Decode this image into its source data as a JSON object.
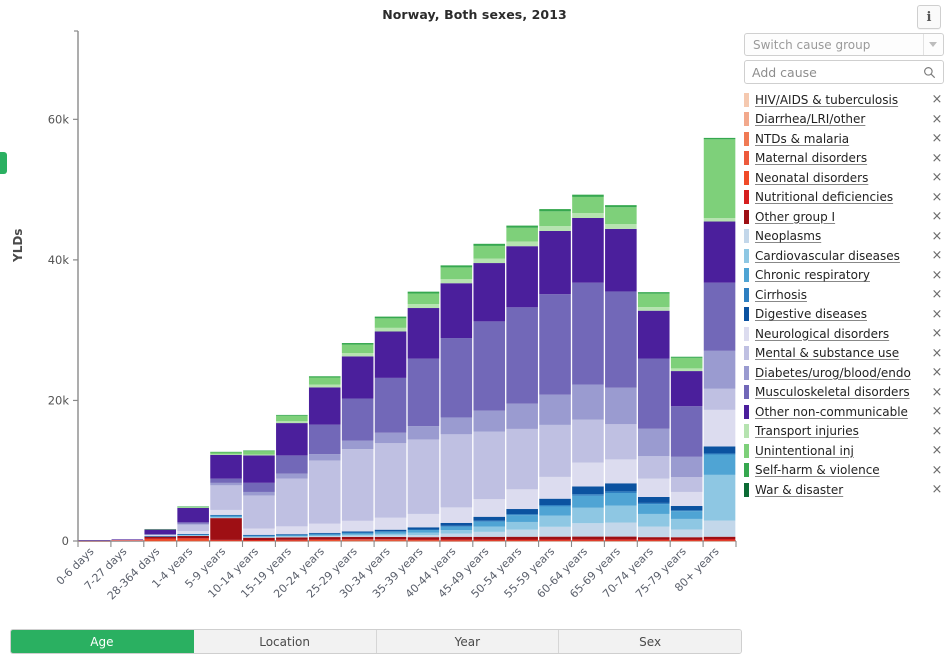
{
  "header": {
    "title": "Norway, Both sexes, 2013",
    "info_button": "i"
  },
  "controls": {
    "cause_group_placeholder": "Switch cause group",
    "add_cause_placeholder": "Add cause",
    "add_cause_value": "",
    "search_icon": "search-icon",
    "remove_icon": "×"
  },
  "legend": {
    "items": [
      {
        "label": "HIV/AIDS & tuberculosis",
        "color": "#f5c9b0"
      },
      {
        "label": "Diarrhea/LRI/other",
        "color": "#f2a98c"
      },
      {
        "label": "NTDs & malaria",
        "color": "#f07a54"
      },
      {
        "label": "Maternal disorders",
        "color": "#ed5a3c"
      },
      {
        "label": "Neonatal disorders",
        "color": "#f04a28"
      },
      {
        "label": "Nutritional deficiencies",
        "color": "#d61f1f"
      },
      {
        "label": "Other group I",
        "color": "#9e0f14"
      },
      {
        "label": "Neoplasms",
        "color": "#c3d7ea"
      },
      {
        "label": "Cardiovascular diseases",
        "color": "#8ec7e3"
      },
      {
        "label": "Chronic respiratory",
        "color": "#4fa4d4"
      },
      {
        "label": "Cirrhosis",
        "color": "#2e7fc1"
      },
      {
        "label": "Digestive diseases",
        "color": "#0b52a0"
      },
      {
        "label": "Neurological disorders",
        "color": "#dcdcef"
      },
      {
        "label": "Mental & substance use",
        "color": "#bfc0e2"
      },
      {
        "label": "Diabetes/urog/blood/endo",
        "color": "#9a9bd0"
      },
      {
        "label": "Musculoskeletal disorders",
        "color": "#7268b8"
      },
      {
        "label": "Other non-communicable",
        "color": "#4b1f9c"
      },
      {
        "label": "Transport injuries",
        "color": "#b6e3b0"
      },
      {
        "label": "Unintentional inj",
        "color": "#7ed07a"
      },
      {
        "label": "Self-harm & violence",
        "color": "#36a84f"
      },
      {
        "label": "War & disaster",
        "color": "#0c6b34"
      }
    ]
  },
  "tabs": {
    "items": [
      {
        "label": "Age",
        "active": true
      },
      {
        "label": "Location",
        "active": false
      },
      {
        "label": "Year",
        "active": false
      },
      {
        "label": "Sex",
        "active": false
      }
    ]
  },
  "chart_data": {
    "type": "bar",
    "stacked": true,
    "title": "Norway, Both sexes, 2013",
    "xlabel": "",
    "ylabel": "YLDs",
    "ylim": [
      0,
      72000
    ],
    "yticks": [
      0,
      20000,
      40000,
      60000
    ],
    "ytick_labels": [
      "0",
      "20k",
      "40k",
      "60k"
    ],
    "grid": false,
    "legend_position": "right",
    "categories": [
      "0-6 days",
      "7-27 days",
      "28-364 days",
      "1-4 years",
      "5-9 years",
      "10-14 years",
      "15-19 years",
      "20-24 years",
      "25-29 years",
      "30-34 years",
      "35-39 years",
      "40-44 years",
      "45-49 years",
      "50-54 years",
      "55-59 years",
      "60-64 years",
      "65-69 years",
      "70-74 years",
      "75-79 years",
      "80+ years"
    ],
    "series": [
      {
        "name": "HIV/AIDS & tuberculosis",
        "color": "#f5c9b0",
        "values": [
          0,
          0,
          0,
          0,
          0,
          0,
          0,
          0,
          0,
          0,
          0,
          0,
          0,
          0,
          0,
          0,
          0,
          0,
          0,
          0
        ]
      },
      {
        "name": "Diarrhea/LRI/other",
        "color": "#f2a98c",
        "values": [
          0,
          0,
          10,
          20,
          20,
          20,
          20,
          20,
          20,
          20,
          20,
          20,
          20,
          20,
          20,
          20,
          20,
          20,
          20,
          20
        ]
      },
      {
        "name": "NTDs & malaria",
        "color": "#f07a54",
        "values": [
          0,
          0,
          0,
          0,
          0,
          0,
          0,
          0,
          0,
          0,
          0,
          0,
          0,
          0,
          0,
          0,
          0,
          0,
          0,
          0
        ]
      },
      {
        "name": "Maternal disorders",
        "color": "#ed5a3c",
        "values": [
          0,
          0,
          0,
          0,
          0,
          0,
          20,
          70,
          90,
          80,
          40,
          10,
          0,
          0,
          0,
          0,
          0,
          0,
          0,
          0
        ]
      },
      {
        "name": "Neonatal disorders",
        "color": "#f04a28",
        "values": [
          60,
          120,
          330,
          330,
          80,
          60,
          60,
          60,
          60,
          60,
          60,
          60,
          60,
          60,
          60,
          60,
          60,
          60,
          60,
          60
        ]
      },
      {
        "name": "Nutritional deficiencies",
        "color": "#d61f1f",
        "values": [
          0,
          10,
          30,
          60,
          60,
          60,
          70,
          80,
          90,
          90,
          100,
          110,
          120,
          130,
          140,
          150,
          150,
          140,
          130,
          200
        ]
      },
      {
        "name": "Other group I",
        "color": "#9e0f14",
        "values": [
          10,
          30,
          300,
          330,
          3100,
          330,
          330,
          330,
          330,
          330,
          330,
          400,
          400,
          400,
          400,
          400,
          400,
          330,
          330,
          330
        ]
      },
      {
        "name": "Neoplasms",
        "color": "#c3d7ea",
        "values": [
          0,
          0,
          20,
          60,
          80,
          80,
          100,
          120,
          160,
          220,
          300,
          450,
          700,
          1000,
          1400,
          1900,
          2000,
          1500,
          1100,
          2300
        ]
      },
      {
        "name": "Cardiovascular diseases",
        "color": "#8ec7e3",
        "values": [
          0,
          0,
          10,
          20,
          40,
          60,
          80,
          110,
          150,
          220,
          330,
          500,
          750,
          1100,
          1600,
          2200,
          2400,
          1800,
          1500,
          6500
        ]
      },
      {
        "name": "Chronic respiratory",
        "color": "#4fa4d4",
        "values": [
          0,
          0,
          20,
          150,
          300,
          200,
          200,
          220,
          260,
          300,
          380,
          500,
          700,
          950,
          1300,
          1700,
          1800,
          1400,
          1100,
          2900
        ]
      },
      {
        "name": "Cirrhosis",
        "color": "#2e7fc1",
        "values": [
          0,
          0,
          0,
          0,
          0,
          10,
          20,
          30,
          40,
          60,
          80,
          110,
          140,
          170,
          200,
          230,
          230,
          170,
          120,
          150
        ]
      },
      {
        "name": "Digestive diseases",
        "color": "#0b52a0",
        "values": [
          0,
          0,
          10,
          20,
          40,
          60,
          80,
          120,
          170,
          230,
          310,
          420,
          560,
          720,
          900,
          1100,
          1150,
          850,
          620,
          1000
        ]
      },
      {
        "name": "Neurological disorders",
        "color": "#dcdcef",
        "values": [
          0,
          10,
          150,
          420,
          700,
          900,
          1100,
          1300,
          1500,
          1700,
          1900,
          2200,
          2500,
          2800,
          3100,
          3400,
          3400,
          2600,
          2000,
          5200
        ]
      },
      {
        "name": "Mental & substance use",
        "color": "#bfc0e2",
        "values": [
          0,
          0,
          60,
          900,
          3500,
          4700,
          6800,
          9000,
          10200,
          10600,
          10600,
          10400,
          9600,
          8600,
          7400,
          6100,
          5000,
          3200,
          2100,
          3000
        ]
      },
      {
        "name": "Diabetes/urog/blood/endo",
        "color": "#9a9bd0",
        "values": [
          0,
          0,
          20,
          150,
          350,
          500,
          700,
          900,
          1200,
          1500,
          1900,
          2400,
          3000,
          3600,
          4300,
          5000,
          5200,
          3900,
          2900,
          5400
        ]
      },
      {
        "name": "Musculoskeletal disorders",
        "color": "#7268b8",
        "values": [
          0,
          0,
          30,
          200,
          600,
          1300,
          2600,
          4200,
          6000,
          7800,
          9600,
          11300,
          12700,
          13700,
          14300,
          14500,
          13700,
          10000,
          7200,
          9700
        ]
      },
      {
        "name": "Other non-communicable",
        "color": "#4b1f9c",
        "values": [
          20,
          60,
          700,
          2100,
          3400,
          3900,
          4600,
          5300,
          6000,
          6600,
          7200,
          7800,
          8300,
          8700,
          9000,
          9200,
          8900,
          6800,
          5000,
          8700
        ]
      },
      {
        "name": "Transport injuries",
        "color": "#b6e3b0",
        "values": [
          0,
          0,
          0,
          20,
          60,
          120,
          260,
          400,
          480,
          520,
          560,
          600,
          640,
          670,
          690,
          700,
          680,
          520,
          380,
          500
        ]
      },
      {
        "name": "Unintentional inj",
        "color": "#7ed07a",
        "values": [
          0,
          0,
          20,
          120,
          330,
          520,
          780,
          1000,
          1200,
          1350,
          1500,
          1650,
          1800,
          1950,
          2100,
          2300,
          2400,
          1900,
          1500,
          11200
        ]
      },
      {
        "name": "Self-harm & violence",
        "color": "#36a84f",
        "values": [
          0,
          0,
          0,
          10,
          30,
          60,
          120,
          180,
          220,
          250,
          270,
          290,
          300,
          310,
          320,
          320,
          300,
          220,
          160,
          200
        ]
      },
      {
        "name": "War & disaster",
        "color": "#0c6b34",
        "values": [
          0,
          0,
          0,
          0,
          0,
          0,
          0,
          0,
          0,
          0,
          0,
          0,
          0,
          0,
          0,
          0,
          0,
          0,
          0,
          0
        ]
      }
    ],
    "totals": [
      90,
      230,
      1710,
      4910,
      12690,
      12880,
      17800,
      23240,
      27890,
      31160,
      34820,
      38680,
      42290,
      44880,
      47250,
      49280,
      47750,
      35410,
      26220,
      57360
    ]
  }
}
